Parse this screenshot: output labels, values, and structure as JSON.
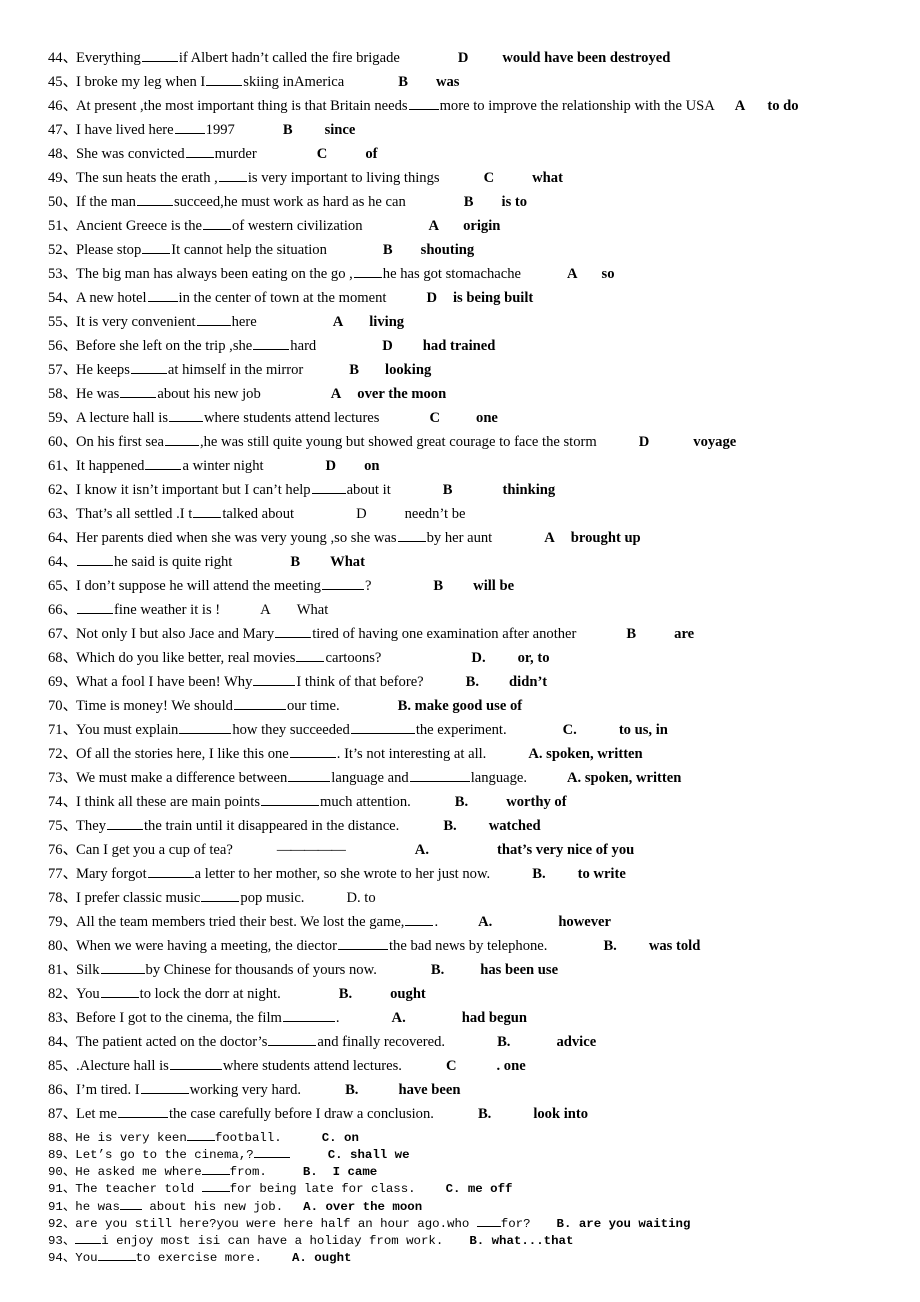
{
  "document": {
    "type": "grammar-answer-key",
    "page_background": "#ffffff",
    "text_color": "#000000"
  },
  "serif_questions": [
    {
      "num": "44、",
      "stem_before": "Everything ",
      "blank": 36,
      "stem_after": "if Albert hadn’t called the fire brigade",
      "gap1": 58,
      "letter": "D",
      "gap2": 34,
      "answer": "would have been destroyed",
      "bold": true
    },
    {
      "num": "45、",
      "stem_before": "I broke my leg when I",
      "blank": 36,
      "stem_after": "skiing inAmerica",
      "gap1": 54,
      "letter": "B",
      "gap2": 28,
      "answer": "was",
      "bold": true
    },
    {
      "num": "46、",
      "stem_before": "At present ,the most important thing is that Britain needs ",
      "blank": 30,
      "stem_after": "more to improve the relationship with the USA",
      "gap1": 20,
      "letter": "A",
      "gap2": 22,
      "answer": "to do",
      "bold": true
    },
    {
      "num": "47、",
      "stem_before": "I have lived here ",
      "blank": 30,
      "stem_after": "1997",
      "gap1": 48,
      "letter": "B",
      "gap2": 32,
      "answer": "since",
      "bold": true
    },
    {
      "num": "48、",
      "stem_before": "She was convicted ",
      "blank": 28,
      "stem_after": "murder",
      "gap1": 60,
      "letter": "C",
      "gap2": 38,
      "answer": "of",
      "bold": true
    },
    {
      "num": "49、",
      "stem_before": "The sun heats the erath , ",
      "blank": 28,
      "stem_after": "is very important to living things",
      "gap1": 44,
      "letter": "C",
      "gap2": 38,
      "answer": "what",
      "bold": true
    },
    {
      "num": "50、",
      "stem_before": "If the man ",
      "blank": 36,
      "stem_after": "succeed,he must work as hard as he can",
      "gap1": 58,
      "letter": "B",
      "gap2": 28,
      "answer": "is to",
      "bold": true
    },
    {
      "num": "51、",
      "stem_before": "Ancient Greece is the ",
      "blank": 28,
      "stem_after": "of western civilization",
      "gap1": 66,
      "letter": "A",
      "gap2": 24,
      "answer": "origin",
      "bold": true
    },
    {
      "num": "52、",
      "stem_before": "Please stop ",
      "blank": 28,
      "stem_after": "It cannot help the situation",
      "gap1": 56,
      "letter": "B",
      "gap2": 28,
      "answer": "shouting",
      "bold": true
    },
    {
      "num": "53、",
      "stem_before": "The big man has always been eating on the go ,",
      "blank": 28,
      "stem_after": "he has got stomachache",
      "gap1": 46,
      "letter": "A",
      "gap2": 24,
      "answer": "so",
      "bold": true
    },
    {
      "num": "54、",
      "stem_before": "A new hotel ",
      "blank": 30,
      "stem_after": "in the center of town at the moment",
      "gap1": 40,
      "letter": "D",
      "gap2": 16,
      "answer": "is being built",
      "bold": true
    },
    {
      "num": "55、",
      "stem_before": "It is very convenient ",
      "blank": 34,
      "stem_after": "here",
      "gap1": 76,
      "letter": "A",
      "gap2": 26,
      "answer": "living",
      "bold": true
    },
    {
      "num": "56、",
      "stem_before": "Before she left on the trip ,she ",
      "blank": 36,
      "stem_after": "hard",
      "gap1": 66,
      "letter": "D",
      "gap2": 30,
      "answer": "had trained",
      "bold": true
    },
    {
      "num": "57、",
      "stem_before": "He keeps ",
      "blank": 36,
      "stem_after": "at himself in the mirror",
      "gap1": 46,
      "letter": "B",
      "gap2": 26,
      "answer": "looking",
      "bold": true
    },
    {
      "num": "58、",
      "stem_before": "He was ",
      "blank": 36,
      "stem_after": "about his new job",
      "gap1": 70,
      "letter": "A",
      "gap2": 16,
      "answer": "over the moon",
      "bold": true
    },
    {
      "num": "59、",
      "stem_before": "A lecture hall is ",
      "blank": 34,
      "stem_after": "where students attend lectures",
      "gap1": 50,
      "letter": "C",
      "gap2": 36,
      "answer": "one",
      "bold": true
    },
    {
      "num": "60、",
      "stem_before": "On his first sea ",
      "blank": 34,
      "stem_after": ",he was still quite young but showed great courage to face the storm",
      "gap1": 42,
      "letter": "D",
      "gap2": 44,
      "answer": "voyage",
      "bold": true
    },
    {
      "num": "61、",
      "stem_before": "It happened ",
      "blank": 36,
      "stem_after": "a winter night",
      "gap1": 62,
      "letter": "D",
      "gap2": 28,
      "answer": "on",
      "bold": true
    },
    {
      "num": "62、",
      "stem_before": "I know it isn’t important but I can’t help ",
      "blank": 34,
      "stem_after": "about it",
      "gap1": 52,
      "letter": "B",
      "gap2": 50,
      "answer": "thinking",
      "bold": true
    },
    {
      "num": "63、",
      "stem_before": "That’s all settled .I t ",
      "blank": 28,
      "stem_after": "talked about",
      "gap1": 62,
      "letter": "D",
      "gap2": 38,
      "answer": "needn’t be",
      "bold": false
    },
    {
      "num": "64、",
      "stem_before": "Her parents died when she was very young ,so she was ",
      "blank": 28,
      "stem_after": "by her aunt",
      "gap1": 52,
      "letter": "A",
      "gap2": 16,
      "answer": "brought up",
      "bold": true
    },
    {
      "num": "64、",
      "stem_before": "",
      "blank": 36,
      "stem_after": "he said is quite right",
      "gap1": 58,
      "letter": "B",
      "gap2": 30,
      "answer": "What",
      "bold": true
    },
    {
      "num": "65、",
      "stem_before": "I don’t suppose he will attend the meeting ",
      "blank": 42,
      "stem_after": "?",
      "gap1": 62,
      "letter": "B",
      "gap2": 30,
      "answer": "will be",
      "bold": true
    },
    {
      "num": "66、",
      "stem_before": "",
      "blank": 36,
      "stem_after": "fine weather it is !",
      "gap1": 40,
      "letter": "A",
      "gap2": 26,
      "answer": "What",
      "bold": false
    },
    {
      "num": "67、",
      "stem_before": "Not only I but also Jace and Mary ",
      "blank": 36,
      "stem_after": "tired of having one examination after another",
      "gap1": 50,
      "letter": "B",
      "gap2": 38,
      "answer": "are",
      "bold": true
    },
    {
      "num": "68、",
      "stem_before": "Which do you like better, real movies ",
      "blank": 28,
      "stem_after": "cartoons?",
      "gap1": 90,
      "letter": "D.",
      "gap2": 32,
      "answer": "or, to",
      "bold": true
    },
    {
      "num": "69、",
      "stem_before": "What a fool I have been! Why ",
      "blank": 42,
      "stem_after": "I think of that before?",
      "gap1": 42,
      "letter": "B.",
      "gap2": 30,
      "answer": "didn’t",
      "bold": true
    },
    {
      "num": "70、",
      "stem_before": "Time is money! We should ",
      "blank": 52,
      "stem_after": "our time.",
      "gap1": 58,
      "letter": "",
      "gap2": 0,
      "answer": "B. make good use of",
      "bold": true
    },
    {
      "num": "71、",
      "stem_before": "You must explain ",
      "blank": 52,
      "stem_after": "how they succeeded ",
      "blank2": 64,
      "stem_after2": "the experiment.",
      "gap1": 56,
      "letter": "C.",
      "gap2": 42,
      "answer": "to us, in",
      "bold": true
    },
    {
      "num": "72、",
      "stem_before": "Of all the stories here, I like this one ",
      "blank": 46,
      "stem_after": ". It’s not interesting at all.",
      "gap1": 42,
      "letter": "",
      "gap2": 0,
      "answer": "A. spoken, written",
      "bold": true
    },
    {
      "num": "73、",
      "stem_before": "We must make a difference between ",
      "blank": 42,
      "stem_after": "language and ",
      "blank2": 60,
      "stem_after2": "language.",
      "gap1": 40,
      "letter": "",
      "gap2": 0,
      "answer": "A. spoken, written",
      "bold": true
    },
    {
      "num": "74、",
      "stem_before": "I think all these are main points ",
      "blank": 58,
      "stem_after": "much attention.",
      "gap1": 44,
      "letter": "B.",
      "gap2": 38,
      "answer": "worthy of",
      "bold": true
    },
    {
      "num": "75、",
      "stem_before": "They ",
      "blank": 36,
      "stem_after": "the train until it disappeared in the distance.",
      "gap1": 44,
      "letter": "B.",
      "gap2": 32,
      "answer": "watched",
      "bold": true
    },
    {
      "num": "76、",
      "stem_before": "Can I get you a cup of tea?",
      "blank": 0,
      "dash": "—————",
      "gap_dash": 44,
      "stem_after": "",
      "gap1": 70,
      "letter": "A.",
      "gap2": 68,
      "answer": "that’s very nice of you",
      "bold": true
    },
    {
      "num": "77、",
      "stem_before": "Mary forgot",
      "blank": 46,
      "stem_after": "a letter to her mother, so she wrote to her just now.",
      "gap1": 42,
      "letter": "B.",
      "gap2": 32,
      "answer": "to write",
      "bold": true
    },
    {
      "num": "78、",
      "stem_before": "I prefer classic music ",
      "blank": 38,
      "stem_after": "pop music.",
      "gap1": 42,
      "letter": "",
      "gap2": 0,
      "answer": "D. to",
      "bold": false
    },
    {
      "num": "79、",
      "stem_before": "All the team members tried their best. We lost the game, ",
      "blank": 28,
      "stem_after": ".",
      "gap1": 40,
      "letter": "A.",
      "gap2": 66,
      "answer": "however",
      "bold": true
    },
    {
      "num": "80、",
      "stem_before": "When we were having a meeting, the diector ",
      "blank": 50,
      "stem_after": "the bad news by telephone.",
      "gap1": 56,
      "letter": "B.",
      "gap2": 32,
      "answer": "was told",
      "bold": true
    },
    {
      "num": "81、",
      "stem_before": "Silk ",
      "blank": 44,
      "stem_after": "by Chinese for thousands of yours now.",
      "gap1": 54,
      "letter": "B.",
      "gap2": 36,
      "answer": "has been use",
      "bold": true
    },
    {
      "num": "82、",
      "stem_before": "You ",
      "blank": 38,
      "stem_after": "to lock the dorr at night.",
      "gap1": 58,
      "letter": "B.",
      "gap2": 38,
      "answer": "ought",
      "bold": true
    },
    {
      "num": "83、",
      "stem_before": "Before I got to the cinema, the film ",
      "blank": 52,
      "stem_after": ".",
      "gap1": 52,
      "letter": "A.",
      "gap2": 56,
      "answer": "had begun",
      "bold": true
    },
    {
      "num": "84、",
      "stem_before": "The patient acted on the doctor’s ",
      "blank": 48,
      "stem_after": "and finally recovered.",
      "gap1": 52,
      "letter": "B.",
      "gap2": 46,
      "answer": "advice",
      "bold": true
    },
    {
      "num": "85、",
      "stem_before": ".Alecture hall is ",
      "blank": 52,
      "stem_after": "where students attend lectures.",
      "gap1": 44,
      "letter": "C",
      "gap2": 40,
      "answer": ". one",
      "bold": true
    },
    {
      "num": "86、",
      "stem_before": "I’m tired. I ",
      "blank": 48,
      "stem_after": "working very hard.",
      "gap1": 44,
      "letter": "B.",
      "gap2": 40,
      "answer": "have been",
      "bold": true
    },
    {
      "num": "87、",
      "stem_before": "Let me ",
      "blank": 50,
      "stem_after": "the case carefully before I draw a conclusion.",
      "gap1": 44,
      "letter": "B.",
      "gap2": 42,
      "answer": "look into",
      "bold": true
    }
  ],
  "mono_questions": [
    {
      "num": "88、",
      "stem_before": "He is very keen",
      "blank": 28,
      "stem_after": "football.",
      "gap1": 40,
      "answer_letter": "C.",
      "answer": " on"
    },
    {
      "num": "89、",
      "stem_before": "Let’s go to the cinema,?",
      "blank": 36,
      "stem_after": "",
      "gap1": 38,
      "answer_letter": "C.",
      "answer": " shall we"
    },
    {
      "num": "90、",
      "stem_before": "He asked me where",
      "blank": 28,
      "stem_after": "from.",
      "gap1": 36,
      "answer_letter": "B.",
      "answer": "  I came"
    },
    {
      "num": "91、",
      "stem_before": "The teacher told ",
      "blank": 28,
      "stem_after": "for being late for class.",
      "gap1": 30,
      "answer_letter": "C.",
      "answer": " me off"
    },
    {
      "num": "91、",
      "stem_before": "he was",
      "blank": 22,
      "stem_after": " about his new job.",
      "gap1": 20,
      "answer_letter": "A.",
      "answer": " over the moon"
    },
    {
      "num": "92、",
      "stem_before": "are you still here?you were here half an hour ago.who ",
      "blank": 24,
      "stem_after": "for?",
      "gap1": 26,
      "answer_letter": "B.",
      "answer": " are you waiting"
    },
    {
      "num": "93、",
      "stem_before": "",
      "blank": 26,
      "stem_after": "i enjoy most isi can have a holiday from work.",
      "gap1": 26,
      "answer_letter": "B.",
      "answer": " what...that"
    },
    {
      "num": "94、",
      "stem_before": "You",
      "blank": 38,
      "stem_after": "to exercise more.",
      "gap1": 30,
      "answer_letter": "A.",
      "answer": " ought"
    }
  ]
}
